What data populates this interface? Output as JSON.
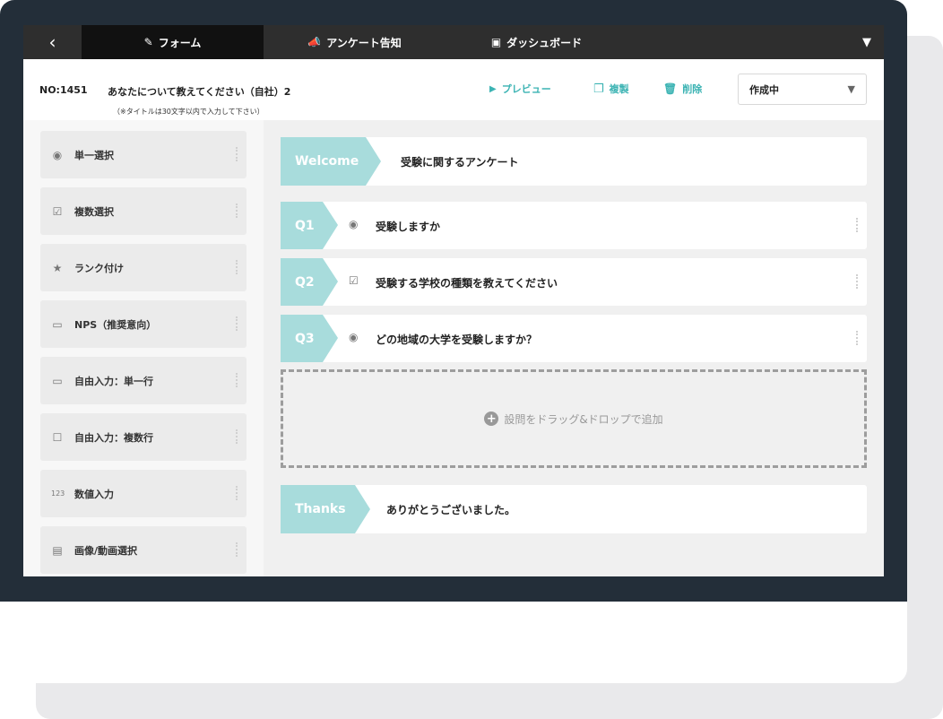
{
  "nav": {
    "tabs": [
      {
        "label": "フォーム",
        "icon": "pencil-icon"
      },
      {
        "label": "アンケート告知",
        "icon": "megaphone-icon"
      },
      {
        "label": "ダッシュボード",
        "icon": "chart-icon"
      }
    ]
  },
  "header": {
    "survey_no": "NO:1451",
    "title": "あなたについて教えてください（自社）2",
    "title_hint": "（※タイトルは30文字以内で入力して下さい）",
    "actions": {
      "preview": "プレビュー",
      "duplicate": "複製",
      "delete": "削除"
    },
    "status": "作成中"
  },
  "palette": [
    {
      "label": "単一選択",
      "icon": "radio-icon"
    },
    {
      "label": "複数選択",
      "icon": "checkbox-icon"
    },
    {
      "label": "ランク付け",
      "icon": "star-icon"
    },
    {
      "label": "NPS（推奨意向）",
      "icon": "nps-icon"
    },
    {
      "label": "自由入力：単一行",
      "icon": "single-line-icon"
    },
    {
      "label": "自由入力：複数行",
      "icon": "multi-line-icon"
    },
    {
      "label": "数値入力",
      "icon": "number-icon",
      "glyph": "123"
    },
    {
      "label": "画像/動画選択",
      "icon": "image-icon"
    }
  ],
  "survey": {
    "welcome": {
      "tag": "Welcome",
      "text": "受験に関するアンケート"
    },
    "questions": [
      {
        "tag": "Q1",
        "type": "radio",
        "text": "受験しますか"
      },
      {
        "tag": "Q2",
        "type": "checkbox",
        "text": "受験する学校の種類を教えてください"
      },
      {
        "tag": "Q3",
        "type": "radio",
        "text": "どの地域の大学を受験しますか？"
      }
    ],
    "dropzone_label": "設問をドラッグ&ドロップで追加",
    "thanks": {
      "tag": "Thanks",
      "text": "ありがとうございました。"
    }
  },
  "colors": {
    "accent": "#3bb3b3",
    "tag_bg": "#a8dcdc",
    "bezel": "#232e39",
    "nav_bg": "#2e2e2e"
  }
}
